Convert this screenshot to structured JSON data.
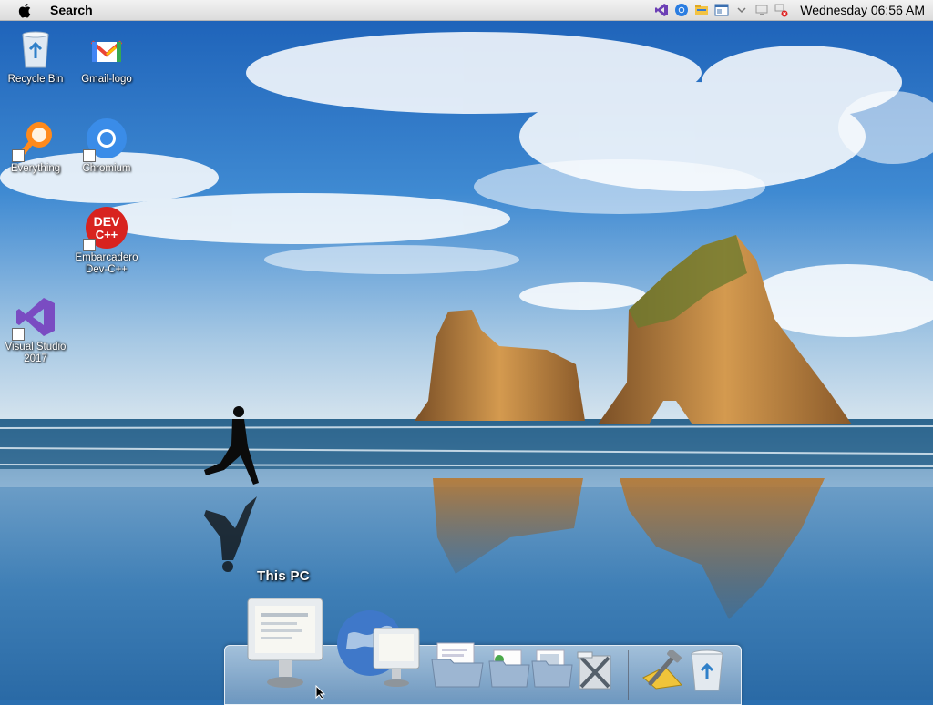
{
  "menubar": {
    "apple_icon": "apple-logo-icon",
    "active_label": "Search",
    "tray_icons": [
      "visual-studio-icon",
      "chromium-icon",
      "file-explorer-icon",
      "window-icon",
      "chevron-down-icon",
      "display-icon",
      "network-disconnected-icon"
    ],
    "clock": "Wednesday 06:56 AM"
  },
  "desktop": {
    "icons": [
      {
        "label": "Recycle Bin",
        "icon": "recycle-bin-icon"
      },
      {
        "label": "Gmail-logo",
        "icon": "gmail-icon"
      },
      {
        "label": "Everything",
        "icon": "everything-search-icon"
      },
      {
        "label": "Chromium",
        "icon": "chromium-icon"
      },
      {
        "label": "Embarcadero Dev-C++",
        "icon": "devcpp-icon",
        "icon_text": "DEV C++"
      },
      {
        "label": "Visual Studio 2017",
        "icon": "visual-studio-icon"
      }
    ]
  },
  "dock": {
    "hover_label": "This PC",
    "items": [
      {
        "icon": "this-pc-icon"
      },
      {
        "icon": "network-globe-icon"
      },
      {
        "icon": "documents-folder-icon"
      },
      {
        "icon": "downloads-folder-icon"
      },
      {
        "icon": "pictures-folder-icon"
      },
      {
        "icon": "applications-folder-icon"
      },
      {
        "icon": "utilities-tools-icon"
      },
      {
        "icon": "trash-icon"
      }
    ]
  },
  "colors": {
    "sky_top": "#1d63b8",
    "sky_horizon": "#cfe0ee",
    "sea": "#3f7fb6",
    "rock": "#b07a3c",
    "menubar": "#e6e6e6"
  }
}
